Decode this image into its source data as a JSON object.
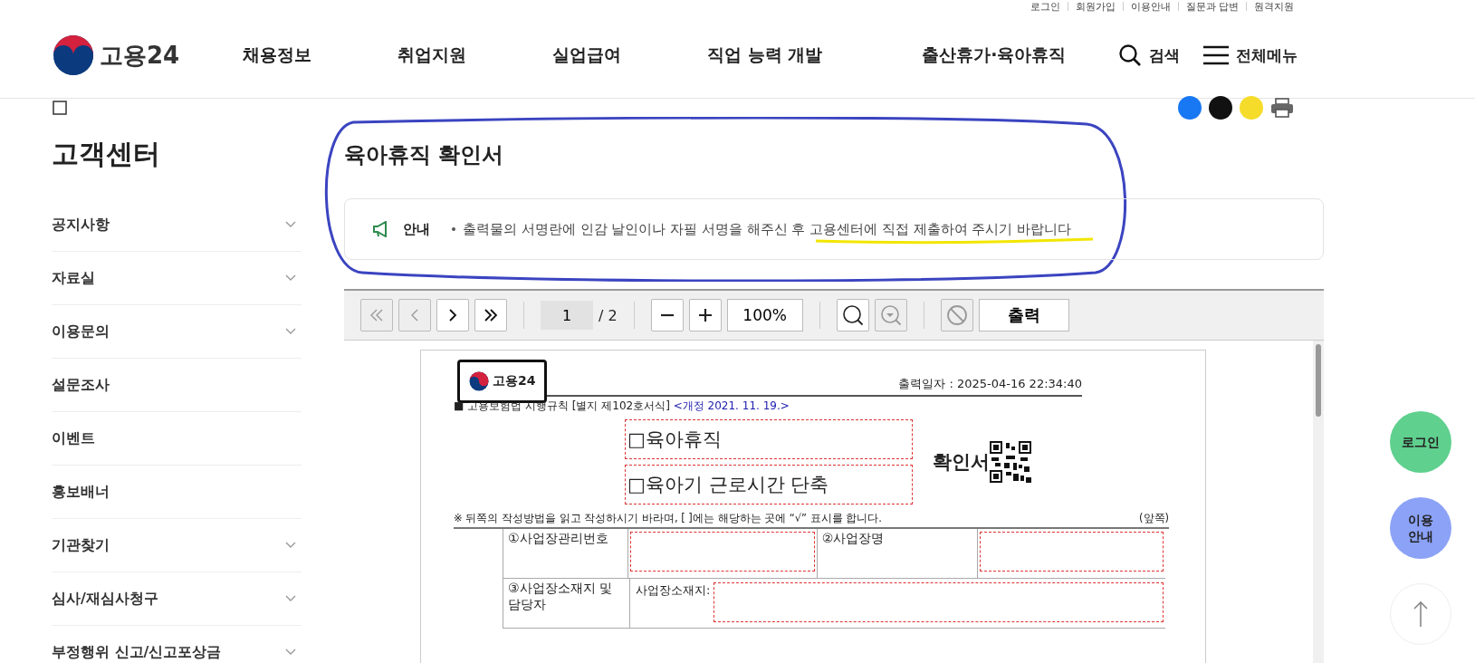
{
  "utility_links": [
    "로그인",
    "회원가입",
    "이용안내",
    "질문과 답변",
    "원격지원"
  ],
  "header": {
    "logo": "고용24",
    "nav": [
      "채용정보",
      "취업지원",
      "실업급여",
      "직업 능력 개발",
      "출산휴가·육아휴직"
    ],
    "search": "검색",
    "menu": "전체메뉴"
  },
  "sidebar": {
    "title": "고객센터",
    "items": [
      {
        "label": "공지사항",
        "expandable": true
      },
      {
        "label": "자료실",
        "expandable": true
      },
      {
        "label": "이용문의",
        "expandable": true
      },
      {
        "label": "설문조사",
        "expandable": false
      },
      {
        "label": "이벤트",
        "expandable": false
      },
      {
        "label": "홍보배너",
        "expandable": false
      },
      {
        "label": "기관찾기",
        "expandable": true
      },
      {
        "label": "심사/재심사청구",
        "expandable": true
      },
      {
        "label": "부정행위 신고/신고포상금",
        "expandable": true
      }
    ]
  },
  "page_title": "육아휴직 확인서",
  "notice": {
    "label": "안내",
    "text": "출력물의 서명란에 인감 날인이나 자필 서명을 해주신 후 고용센터에 직접 제출하여 주시기 바랍니다"
  },
  "viewer": {
    "nav_buttons": [
      {
        "kind": "first",
        "disabled": true
      },
      {
        "kind": "prev",
        "disabled": true
      },
      {
        "kind": "next",
        "disabled": false
      },
      {
        "kind": "last",
        "disabled": false
      }
    ],
    "page": "1",
    "total": "/ 2",
    "zoom": "100%",
    "print": "출력",
    "document": {
      "logo": "고용24",
      "printed_at": "출력일자 : 2025-04-16 22:34:40",
      "law": "■ 고용보험법 시행규칙 [별지 제102호서식]",
      "revision": "<개정 2021. 11. 19.>",
      "options": [
        "□육아휴직",
        "□육아기 근로시간 단축"
      ],
      "form_title": "확인서",
      "instruction": "※ 뒤쪽의 작성방법을 읽고 작성하시기 바라며, [  ]에는 해당하는 곳에 “√” 표시를 합니다.",
      "side": "(앞쪽)",
      "fields": {
        "number": "①사업장관리번호",
        "name": "②사업장명",
        "address": "③사업장소재지 및 담당자",
        "address_label": "사업장소재지:"
      }
    }
  },
  "floating": [
    {
      "label": "로그인",
      "color": "#5fd08e"
    },
    {
      "label": "이용 안내",
      "color": "#8ba2f7"
    }
  ]
}
